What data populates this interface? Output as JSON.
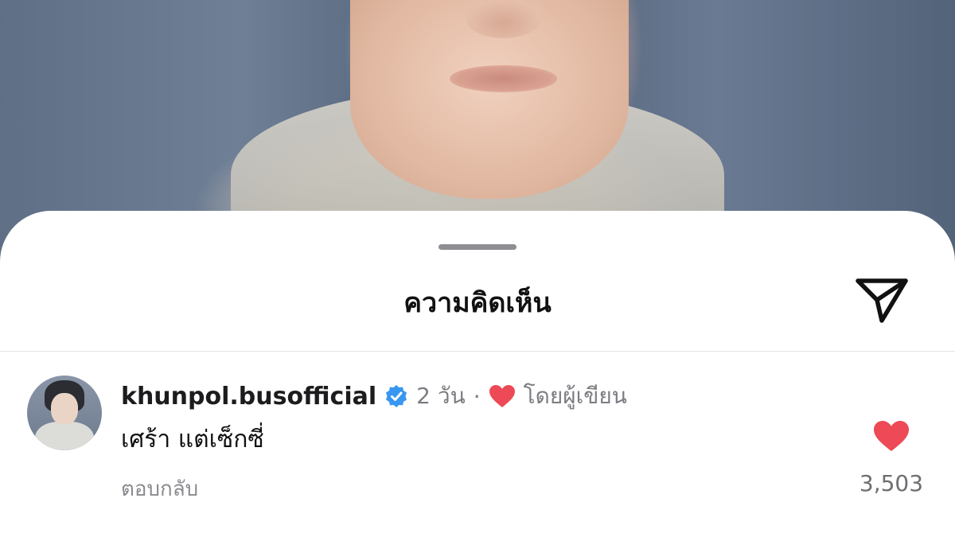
{
  "sheet": {
    "title": "ความคิดเห็น",
    "share_icon": "send-icon"
  },
  "comment": {
    "username": "khunpol.busofficial",
    "verified": true,
    "verified_color": "#3897f0",
    "time": "2 วัน",
    "separator": "·",
    "author_badge_icon": "heart-icon",
    "author_badge_color": "#ed4956",
    "author_label": "โดยผู้เขียน",
    "text": "เศร้า แต่เซ็กซี่",
    "reply_label": "ตอบกลับ",
    "liked": true,
    "like_color": "#ed4956",
    "like_count": "3,503"
  }
}
